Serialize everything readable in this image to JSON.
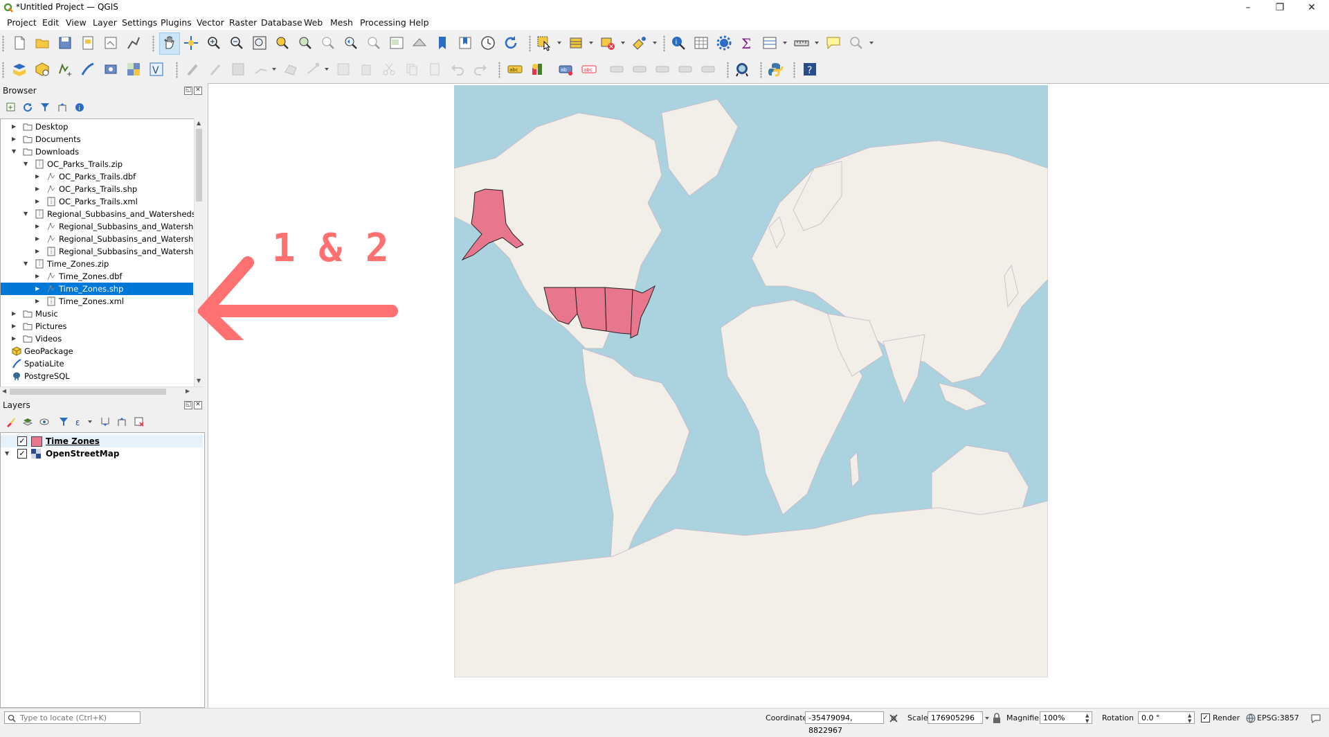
{
  "window": {
    "title": "*Untitled Project — QGIS"
  },
  "menu": [
    "Project",
    "Edit",
    "View",
    "Layer",
    "Settings",
    "Plugins",
    "Vector",
    "Raster",
    "Database",
    "Web",
    "Mesh",
    "Processing",
    "Help"
  ],
  "browser": {
    "title": "Browser",
    "items": [
      {
        "label": "Desktop",
        "depth": 0,
        "arrow": "right",
        "icon": "folder"
      },
      {
        "label": "Documents",
        "depth": 0,
        "arrow": "right",
        "icon": "folder"
      },
      {
        "label": "Downloads",
        "depth": 0,
        "arrow": "down",
        "icon": "folder"
      },
      {
        "label": "OC_Parks_Trails.zip",
        "depth": 1,
        "arrow": "down",
        "icon": "zip"
      },
      {
        "label": "OC_Parks_Trails.dbf",
        "depth": 2,
        "arrow": "right",
        "icon": "vector"
      },
      {
        "label": "OC_Parks_Trails.shp",
        "depth": 2,
        "arrow": "right",
        "icon": "vector"
      },
      {
        "label": "OC_Parks_Trails.xml",
        "depth": 2,
        "arrow": "right",
        "icon": "zip"
      },
      {
        "label": "Regional_Subbasins_and_Watersheds.zi",
        "depth": 1,
        "arrow": "down",
        "icon": "zip"
      },
      {
        "label": "Regional_Subbasins_and_Watershed",
        "depth": 2,
        "arrow": "right",
        "icon": "vector"
      },
      {
        "label": "Regional_Subbasins_and_Watershed",
        "depth": 2,
        "arrow": "right",
        "icon": "vector"
      },
      {
        "label": "Regional_Subbasins_and_Watershed",
        "depth": 2,
        "arrow": "right",
        "icon": "zip"
      },
      {
        "label": "Time_Zones.zip",
        "depth": 1,
        "arrow": "down",
        "icon": "zip"
      },
      {
        "label": "Time_Zones.dbf",
        "depth": 2,
        "arrow": "right",
        "icon": "vector"
      },
      {
        "label": "Time_Zones.shp",
        "depth": 2,
        "arrow": "right",
        "icon": "vector",
        "selected": true
      },
      {
        "label": "Time_Zones.xml",
        "depth": 2,
        "arrow": "right",
        "icon": "zip"
      },
      {
        "label": "Music",
        "depth": 0,
        "arrow": "right",
        "icon": "folder"
      },
      {
        "label": "Pictures",
        "depth": 0,
        "arrow": "right",
        "icon": "folder"
      },
      {
        "label": "Videos",
        "depth": 0,
        "arrow": "right",
        "icon": "folder"
      },
      {
        "label": "GeoPackage",
        "depth": -1,
        "arrow": "none",
        "icon": "geopackage"
      },
      {
        "label": "SpatiaLite",
        "depth": -1,
        "arrow": "none",
        "icon": "spatialite"
      },
      {
        "label": "PostgreSQL",
        "depth": -1,
        "arrow": "none",
        "icon": "postgres"
      }
    ]
  },
  "layers": {
    "title": "Layers",
    "items": [
      {
        "label": "Time Zones",
        "checked": true,
        "color": "#e8778d",
        "active": true
      },
      {
        "label": "OpenStreetMap",
        "checked": true,
        "expanded": true
      }
    ]
  },
  "annotation": {
    "text": "1 & 2",
    "color": "#ff7070"
  },
  "map": {
    "ocean": "#aad3df",
    "land": "#f2efe9",
    "highlight": "#e8778d"
  },
  "statusbar": {
    "locator_placeholder": "Type to locate (Ctrl+K)",
    "coordinate_label": "Coordinate",
    "coordinate_value": "-35479094, 8822967",
    "scale_label": "Scale",
    "scale_value": "176905296",
    "magnifier_label": "Magnifier",
    "magnifier_value": "100%",
    "rotation_label": "Rotation",
    "rotation_value": "0.0 °",
    "render_label": "Render",
    "crs": "EPSG:3857"
  }
}
